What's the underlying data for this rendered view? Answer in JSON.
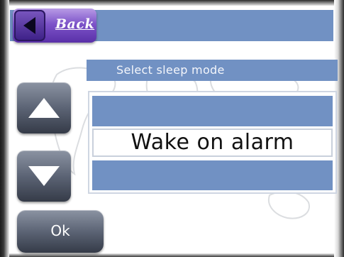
{
  "header": {
    "back_label": "Back",
    "back_icon": "chevron-left-icon"
  },
  "screen": {
    "title": "Select sleep mode"
  },
  "options": {
    "items": [
      "",
      "Wake on alarm",
      ""
    ],
    "selected": "Wake on alarm"
  },
  "controls": {
    "up_icon": "arrow-up-icon",
    "down_icon": "arrow-down-icon",
    "ok_label": "Ok"
  },
  "colors": {
    "accent_bar": "#7191c3",
    "back_button": "#7d54c9",
    "side_button": "#5c6475",
    "text_dark": "#111111"
  }
}
